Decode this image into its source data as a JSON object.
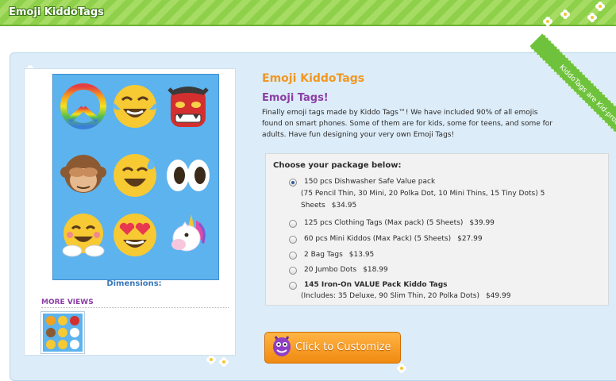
{
  "header": {
    "title": "Emoji KiddoTags"
  },
  "product": {
    "name": "Emoji KiddoTags",
    "subtitle": "Emoji Tags!",
    "description": "Finally emoji tags made by Kiddo Tags™! We have included 90% of all emojis found on smart phones. Some of them are for kids, some for teens, and some for adults. Have fun designing your very own Emoji Tags!",
    "dimensions_label": "Dimensions:",
    "more_views_label": "MORE VIEWS",
    "ribbon_text": "KiddoTags are Kid-proof!"
  },
  "packages": {
    "heading": "Choose your package below:",
    "options": [
      {
        "label": "150 pcs Dishwasher Safe Value pack",
        "detail": "(75 Pencil Thin, 30 Mini, 20 Polka Dot, 10 Mini Thins, 15 Tiny Dots) 5",
        "detail2": "Sheets",
        "price": "$34.95",
        "selected": true
      },
      {
        "label": "125 pcs Clothing Tags (Max pack) (5 Sheets)",
        "price": "$39.99",
        "selected": false
      },
      {
        "label": "60 pcs Mini Kiddos (Max Pack) (5 Sheets)",
        "price": "$27.99",
        "selected": false
      },
      {
        "label": "2 Bag Tags",
        "price": "$13.95",
        "selected": false
      },
      {
        "label": "20 Jumbo Dots",
        "price": "$18.99",
        "selected": false
      },
      {
        "label": "145 Iron-On VALUE Pack Kiddo Tags",
        "detail": "(Includes: 35 Deluxe, 90 Slim Thin, 20 Polka Dots)",
        "price": "$49.99",
        "selected": false
      }
    ]
  },
  "cta": {
    "label": "Click to Customize"
  },
  "colors": {
    "accent_orange": "#f29720",
    "accent_purple": "#8c3fa6",
    "banner_green": "#8fd04a",
    "panel_blue": "#dcecf8"
  },
  "icons": [
    "peace-emoji-icon",
    "tears-of-joy-emoji-icon",
    "oni-mask-emoji-icon",
    "see-no-evil-monkey-emoji-icon",
    "sweat-smile-emoji-icon",
    "eyes-emoji-icon",
    "hug-emoji-icon",
    "heart-eyes-emoji-icon",
    "unicorn-emoji-icon",
    "monster-icon",
    "flower-icon"
  ]
}
